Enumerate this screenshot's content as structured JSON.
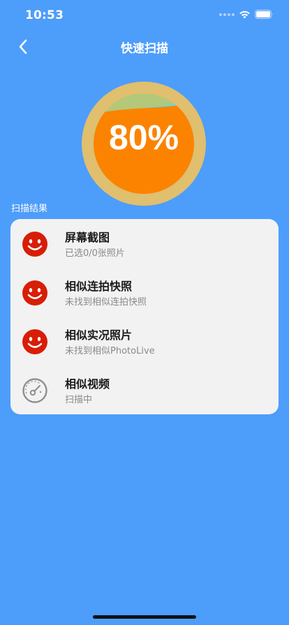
{
  "status": {
    "time": "10:53"
  },
  "nav": {
    "title": "快速扫描",
    "back_icon": "chevron-left-icon"
  },
  "gauge": {
    "percent_text": "80%",
    "progress": 0.8,
    "colors": {
      "ring": "#e0bf6e",
      "fill": "#fc8300",
      "wave_green": "#a8bd68",
      "wave_teal": "#7ecfc8"
    }
  },
  "section": {
    "label": "扫描结果"
  },
  "results": [
    {
      "title": "屏幕截图",
      "subtitle": "已选0/0张照片",
      "icon": "smiley-icon",
      "color": "#d81e06"
    },
    {
      "title": "相似连拍快照",
      "subtitle": "未找到相似连拍快照",
      "icon": "smiley-icon",
      "color": "#d81e06"
    },
    {
      "title": "相似实况照片",
      "subtitle": "未找到相似PhotoLive",
      "icon": "smiley-icon",
      "color": "#d81e06"
    },
    {
      "title": "相似视频",
      "subtitle": "扫描中",
      "icon": "speedometer-icon",
      "color": "#8e8e93"
    }
  ],
  "colors": {
    "background": "#4d9dfb",
    "card": "#f2f2f2"
  }
}
